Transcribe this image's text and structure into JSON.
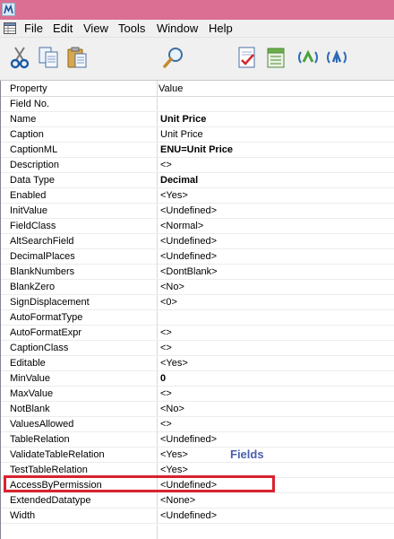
{
  "menubar": {
    "items": [
      "File",
      "Edit",
      "View",
      "Tools",
      "Window",
      "Help"
    ]
  },
  "toolbar": {
    "buttons": [
      "cut-icon",
      "copy-icon",
      "paste-icon",
      "find-icon",
      "properties-icon",
      "database-icon",
      "refresh-left-icon",
      "refresh-right-icon"
    ]
  },
  "grid": {
    "headers": {
      "property": "Property",
      "value": "Value"
    },
    "rows": [
      {
        "property": "Field No.",
        "value": ""
      },
      {
        "property": "Name",
        "value": "Unit Price",
        "bold": true
      },
      {
        "property": "Caption",
        "value": "Unit Price"
      },
      {
        "property": "CaptionML",
        "value": "ENU=Unit Price",
        "bold": true
      },
      {
        "property": "Description",
        "value": "<>"
      },
      {
        "property": "Data Type",
        "value": "Decimal",
        "bold": true
      },
      {
        "property": "Enabled",
        "value": "<Yes>"
      },
      {
        "property": "InitValue",
        "value": "<Undefined>"
      },
      {
        "property": "FieldClass",
        "value": "<Normal>"
      },
      {
        "property": "AltSearchField",
        "value": "<Undefined>"
      },
      {
        "property": "DecimalPlaces",
        "value": "<Undefined>"
      },
      {
        "property": "BlankNumbers",
        "value": "<DontBlank>"
      },
      {
        "property": "BlankZero",
        "value": "<No>"
      },
      {
        "property": "SignDisplacement",
        "value": "<0>"
      },
      {
        "property": "AutoFormatType",
        "value": ""
      },
      {
        "property": "AutoFormatExpr",
        "value": "<>"
      },
      {
        "property": "CaptionClass",
        "value": "<>"
      },
      {
        "property": "Editable",
        "value": "<Yes>"
      },
      {
        "property": "MinValue",
        "value": "0",
        "bold": true
      },
      {
        "property": "MaxValue",
        "value": "<>"
      },
      {
        "property": "NotBlank",
        "value": "<No>"
      },
      {
        "property": "ValuesAllowed",
        "value": "<>"
      },
      {
        "property": "TableRelation",
        "value": "<Undefined>"
      },
      {
        "property": "ValidateTableRelation",
        "value": "<Yes>"
      },
      {
        "property": "TestTableRelation",
        "value": "<Yes>"
      },
      {
        "property": "AccessByPermission",
        "value": "<Undefined>"
      },
      {
        "property": "ExtendedDatatype",
        "value": "<None>"
      },
      {
        "property": "Width",
        "value": "<Undefined>"
      }
    ]
  },
  "annotation": {
    "text": "Fields",
    "color": "#4a5fae"
  },
  "highlight": {
    "color": "#d9232f",
    "row": "AccessByPermission"
  }
}
